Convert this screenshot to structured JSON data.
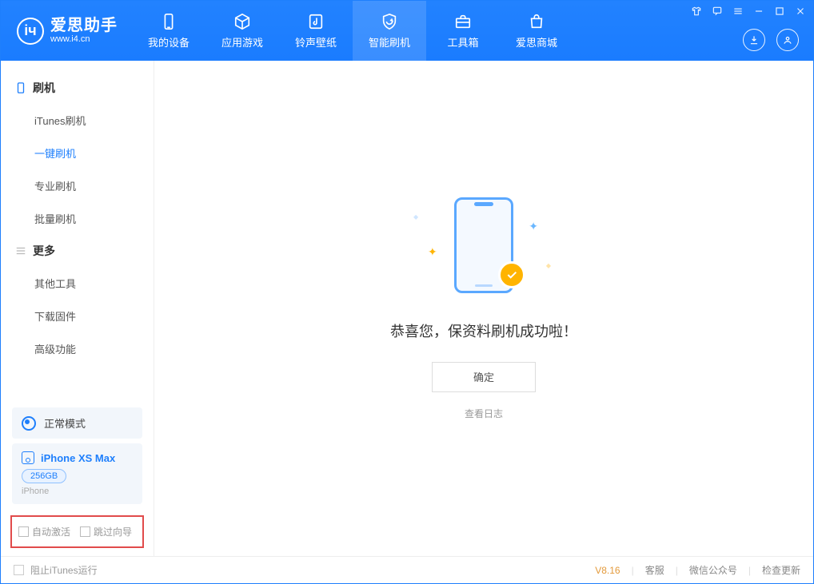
{
  "app": {
    "title": "爱思助手",
    "subtitle": "www.i4.cn"
  },
  "nav": {
    "items": [
      {
        "label": "我的设备"
      },
      {
        "label": "应用游戏"
      },
      {
        "label": "铃声壁纸"
      },
      {
        "label": "智能刷机"
      },
      {
        "label": "工具箱"
      },
      {
        "label": "爱思商城"
      }
    ]
  },
  "sidebar": {
    "group1": {
      "title": "刷机",
      "items": [
        "iTunes刷机",
        "一键刷机",
        "专业刷机",
        "批量刷机"
      ]
    },
    "group2": {
      "title": "更多",
      "items": [
        "其他工具",
        "下载固件",
        "高级功能"
      ]
    },
    "status_label": "正常模式",
    "device": {
      "name": "iPhone XS Max",
      "storage": "256GB",
      "type": "iPhone"
    },
    "options": {
      "auto_activate": "自动激活",
      "skip_guide": "跳过向导"
    }
  },
  "main": {
    "success_msg": "恭喜您，保资料刷机成功啦！",
    "ok_label": "确定",
    "log_label": "查看日志"
  },
  "footer": {
    "block_itunes": "阻止iTunes运行",
    "version": "V8.16",
    "links": {
      "service": "客服",
      "wechat": "微信公众号",
      "update": "检查更新"
    }
  }
}
